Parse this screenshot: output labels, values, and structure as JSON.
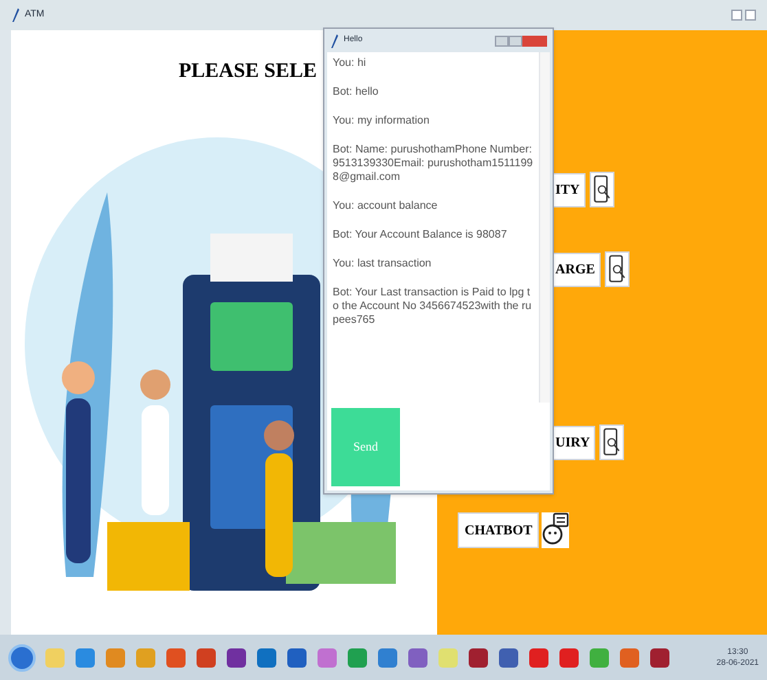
{
  "main_window": {
    "title": "ATM",
    "heading": "PLEASE SELE",
    "option_buttons": [
      {
        "kind": "text_icon",
        "label": "ITY"
      },
      {
        "kind": "text_icon",
        "label": "ARGE"
      },
      {
        "kind": "text_icon",
        "label": "UIRY"
      },
      {
        "kind": "bot",
        "label": "CHATBOT"
      }
    ]
  },
  "chat_window": {
    "title": "Hello",
    "messages": [
      "You: hi",
      "Bot: hello",
      "You: my information",
      "Bot: Name:  purushothamPhone Number:  9513139330Email:  purushotham15111998@gmail.com",
      "You: account balance",
      "Bot: Your Account Balance is 98087",
      "You: last transaction",
      "Bot: Your Last transaction is Paid to lpg to the Account No 3456674523with the rupees765"
    ],
    "send_button": "Send"
  },
  "taskbar": {
    "clock_time": "13:30",
    "clock_date": "28-06-2021"
  }
}
